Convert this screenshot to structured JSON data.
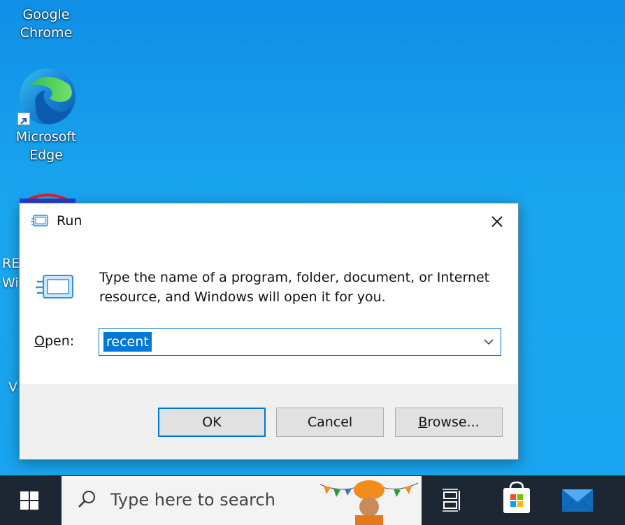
{
  "desktop": {
    "icons": [
      {
        "label_line1": "Google",
        "label_line2": "Chrome"
      },
      {
        "label_line1": "Microsoft",
        "label_line2": "Edge"
      }
    ],
    "partial_labels": [
      "RE",
      "Wi",
      "V"
    ]
  },
  "run_dialog": {
    "title": "Run",
    "description_line1": "Type the name of a program, folder, document, or Internet",
    "description_line2": "resource, and Windows will open it for you.",
    "open_label_prefix": "O",
    "open_label_rest": "pen:",
    "open_value": "recent",
    "ok_label": "OK",
    "cancel_label": "Cancel",
    "browse_label_prefix": "B",
    "browse_label_rest": "rowse..."
  },
  "taskbar": {
    "search_placeholder": "Type here to search"
  },
  "colors": {
    "accent": "#0078d7",
    "desktop": "#18a4ee",
    "taskbar": "#1d2733"
  }
}
